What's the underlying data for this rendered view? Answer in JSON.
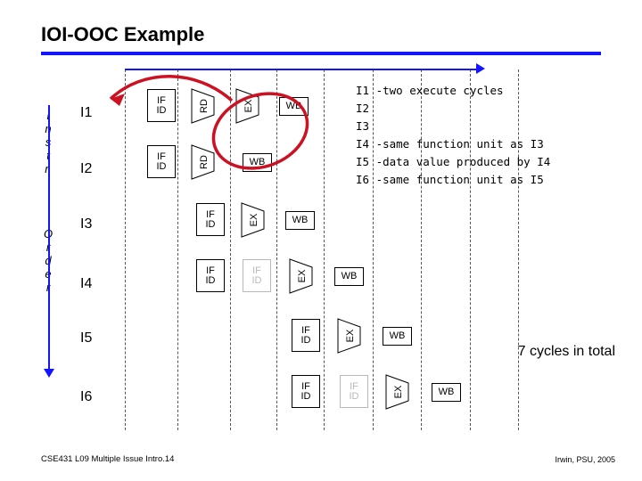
{
  "slide": {
    "title": "IOI-OOC Example",
    "footer_left": "CSE431 L09 Multiple Issue Intro.14",
    "footer_right": "Irwin, PSU, 2005",
    "total_note": "7 cycles in total"
  },
  "axis": {
    "instr_label_chars": [
      "I",
      "n",
      "s",
      "t",
      "r."
    ],
    "order_label_chars": [
      "O",
      "r",
      "d",
      "e",
      "r"
    ]
  },
  "instructions": [
    {
      "label": "I1"
    },
    {
      "label": "I2"
    },
    {
      "label": "I3"
    },
    {
      "label": "I4"
    },
    {
      "label": "I5"
    },
    {
      "label": "I6"
    }
  ],
  "notes": [
    "I1 -two execute cycles",
    "I2",
    "I3",
    "I4 -same function unit as I3",
    "I5 -data value produced by I4",
    "I6 -same function unit as I5"
  ],
  "stages": {
    "ifid_line1": "IF",
    "ifid_line2": "ID",
    "reg_read": "RD",
    "execute": "EX",
    "write_back": "WB"
  },
  "colors": {
    "accent_blue": "#1414ff",
    "lasso_red": "#cc1122",
    "faded_gray": "#b8b8b8"
  }
}
